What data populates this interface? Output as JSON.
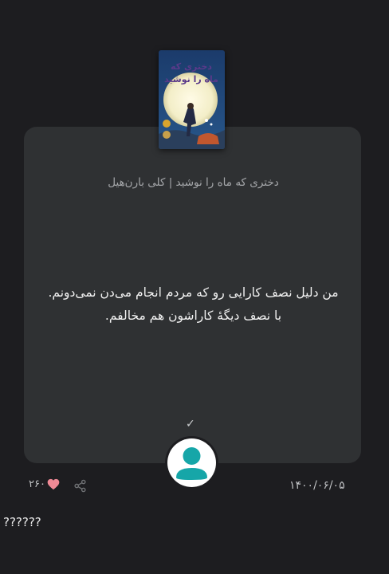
{
  "post": {
    "book_meta": "دختری که ماه را نوشید | کلی بارن‌هیل",
    "cover_title_line1": "دختری که",
    "cover_title_line2": "ماه را نوشید",
    "quote": "من دلیل نصف کارایی رو که مردم انجام می‌دن نمی‌دونم. با نصف دیگهٔ کاراشون هم مخالفم.",
    "check_mark": "✓",
    "likes": "۲۶۰",
    "date": "۱۴۰۰/۰۶/۰۵"
  },
  "comment": {
    "text": "??????"
  },
  "icons": {
    "heart": "heart-icon",
    "share": "share-icon",
    "avatar": "user-avatar-icon"
  },
  "colors": {
    "background": "#1d1d20",
    "card": "#2f3133",
    "heart": "#f08a96",
    "avatar": "#16a6a8"
  }
}
